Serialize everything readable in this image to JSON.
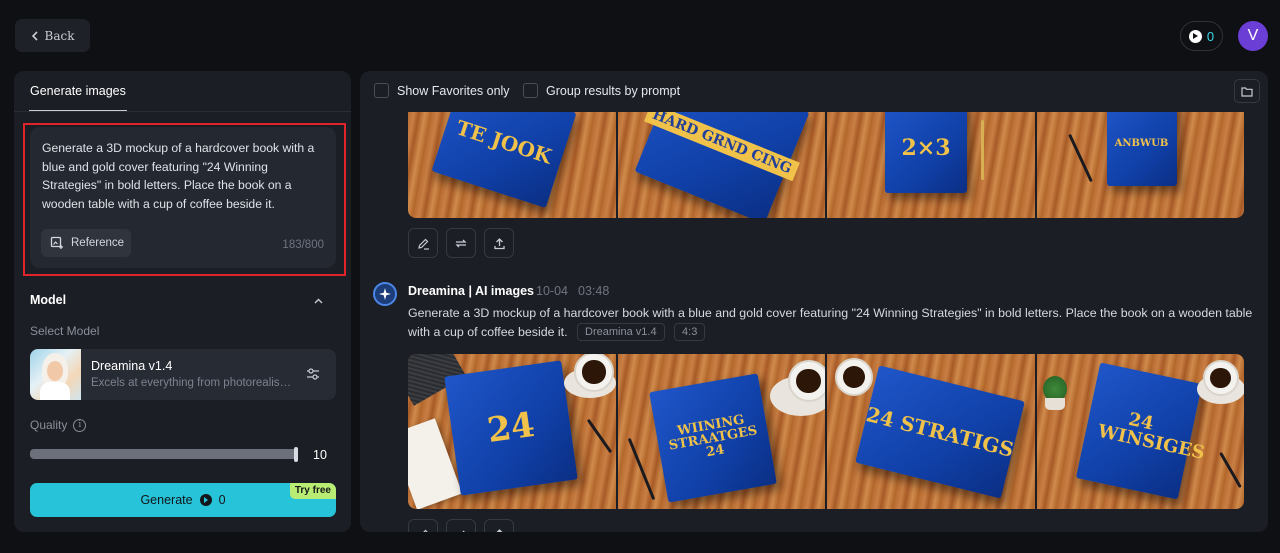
{
  "header": {
    "back_label": "Back",
    "credits": "0",
    "avatar_letter": "V"
  },
  "left": {
    "tab_label": "Generate images",
    "prompt_text": "Generate a 3D mockup of a hardcover book with a blue and gold cover featuring \"24 Winning Strategies\" in bold letters. Place the book on a wooden table with a cup of coffee beside it.",
    "reference_label": "Reference",
    "char_count": "183/800",
    "model_section": "Model",
    "select_model_label": "Select Model",
    "model_name": "Dreamina v1.4",
    "model_desc": "Excels at everything from photorealism to painterly",
    "quality_label": "Quality",
    "quality_value": "10",
    "quality_fraction": 1.0,
    "generate_label": "Generate",
    "generate_credits": "0",
    "try_free_label": "Try free"
  },
  "right": {
    "show_favorites_label": "Show Favorites only",
    "group_results_label": "Group results by prompt",
    "top_images": [
      {
        "title": "TE JOOK"
      },
      {
        "title": "HARD GRND CING"
      },
      {
        "title": "2×3"
      },
      {
        "title": "ANBWUB"
      }
    ],
    "result": {
      "title": "Dreamina | AI images",
      "date": "10-04",
      "time": "03:48",
      "prompt": "Generate a 3D mockup of a hardcover book with a blue and gold cover featuring \"24 Winning Strategies\" in bold letters. Place the book on a wooden table with a cup of coffee beside it.",
      "model_tag": "Dreamina v1.4",
      "ratio_tag": "4:3",
      "images": [
        {
          "title": "24"
        },
        {
          "title": "WIINING STRAATGES 24"
        },
        {
          "title": "24 STRATIGS"
        },
        {
          "title": "24 WINSIGES"
        }
      ]
    }
  },
  "colors": {
    "accent": "#27c3d8",
    "highlight": "#e0242a",
    "try_free": "#b8ec72",
    "avatar": "#6b3fd6",
    "book_blue": "#1a4fc0",
    "book_gold": "#f1c24a"
  },
  "icons": [
    "chevron-left-icon",
    "credit-icon",
    "reference-image-icon",
    "chevron-up-icon",
    "sliders-icon",
    "info-icon",
    "folder-icon",
    "edit-icon",
    "regenerate-icon",
    "upload-icon",
    "dreamina-logo-icon"
  ]
}
